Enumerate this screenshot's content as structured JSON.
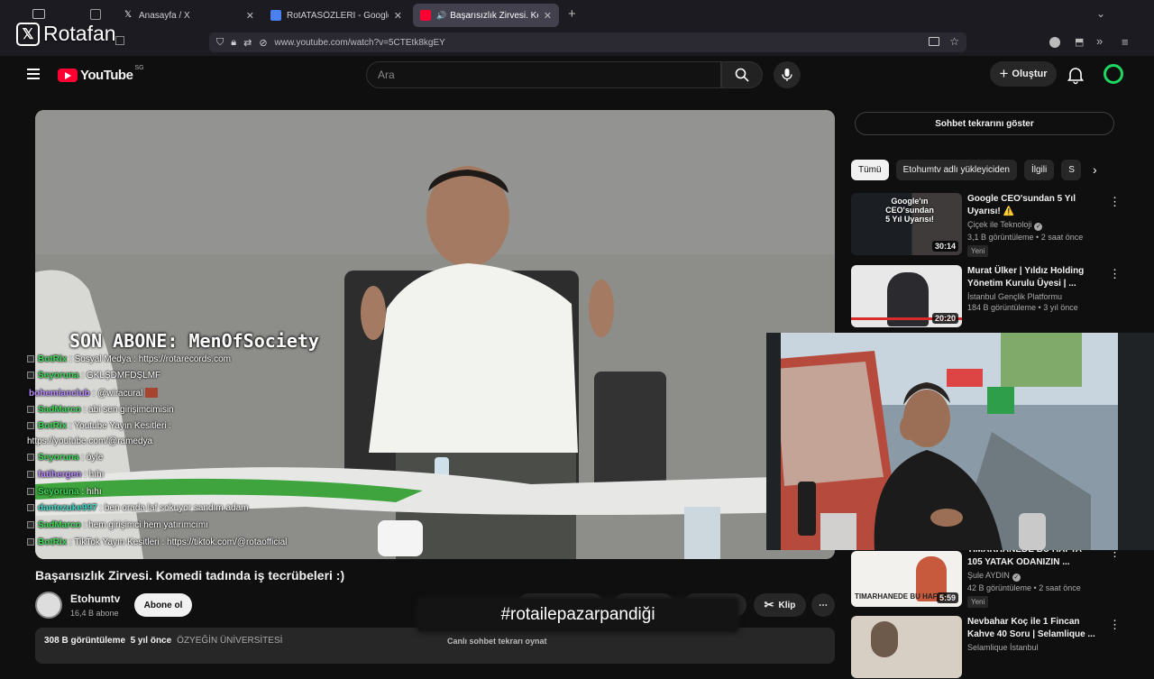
{
  "overlay": {
    "brand": "Rotafan"
  },
  "browser": {
    "tabs": [
      {
        "title": "Anasayfa / X",
        "icon": "x-icon"
      },
      {
        "title": "RotATASÖZLERİ - Google Doküman",
        "icon": "docs-icon"
      },
      {
        "title": "Başarısızlık Zirvesi. Komedi tadında",
        "icon": "youtube-icon",
        "active": true
      }
    ],
    "url": "www.youtube.com/watch?v=5CTEtk8kgEY"
  },
  "header": {
    "logo_text": "YouTube",
    "region": "SG",
    "search_placeholder": "Ara",
    "create_label": "Oluştur"
  },
  "player": {
    "overlay_text": "SON ABONE: MenOfSociety",
    "chat": [
      {
        "name": "BotRix",
        "color": "#41d95b",
        "text": ": Sosyal Medya : https://rotarecords.com"
      },
      {
        "name": "Seyoruna",
        "color": "#41d95b",
        "text": ": GKLŞDMFDŞLMF"
      },
      {
        "name": "bohemianclub",
        "color": "#b98cff",
        "text": ": @wiracural"
      },
      {
        "name": "SadMarco",
        "color": "#41d95b",
        "text": ": abi sen girişimcimisin"
      },
      {
        "name": "BotRix",
        "color": "#41d95b",
        "text": ": Youtube Yayın Kesitleri :"
      },
      {
        "name": "",
        "color": "#ffffff",
        "text": "https://youtube.com/@ramedya"
      },
      {
        "name": "Seyoruna",
        "color": "#41d95b",
        "text": ": öyle"
      },
      {
        "name": "fatihergen",
        "color": "#b98cff",
        "text": ": hıhı"
      },
      {
        "name": "Seyoruna",
        "color": "#41d95b",
        "text": ": hıhı"
      },
      {
        "name": "dantezuke997",
        "color": "#41d9c8",
        "text": ": ben orada laf sokuyor sandım adam"
      },
      {
        "name": "SadMarco",
        "color": "#41d95b",
        "text": ": hem girişimci hem yatırımcımı"
      },
      {
        "name": "BotRix",
        "color": "#41d95b",
        "text": ": TikTok Yayın Kesitleri : https://tiktok.com/@rotaofficial"
      }
    ]
  },
  "video": {
    "title": "Başarısızlık Zirvesi. Komedi tadında iş tecrübeleri :)",
    "channel": "Etohumtv",
    "subscribers": "16,4 B abone",
    "subscribe_label": "Abone ol",
    "clip_label": "Klip",
    "views": "308 B görüntüleme",
    "age": "5 yıl önce",
    "desc_channel": "ÖZYEĞİN ÜNİVERSİTESİ"
  },
  "banner": {
    "hashtag": "#rotailepazarpandiği"
  },
  "live_replay": "Canlı sohbet tekrarı oynat",
  "sidebar": {
    "chat_replay_label": "Sohbet tekrarını göster",
    "chips": [
      "Tümü",
      "Etohumtv adlı yükleyiciden",
      "İlgili",
      "S"
    ],
    "recs": [
      {
        "title": "Google CEO'sundan 5 Yıl Uyarısı! ⚠️",
        "channel": "Çiçek ile Teknoloji",
        "verified": true,
        "meta": "3,1 B görüntüleme • 2 saat önce",
        "badge": "Yeni",
        "duration": "30:14",
        "thumb_text": "Google'ın CEO'sundan 5 Yıl Uyarısı!"
      },
      {
        "title": "Murat Ülker | Yıldız Holding Yönetim Kurulu Üyesi | ...",
        "channel": "İstanbul Gençlik Platformu",
        "verified": false,
        "meta": "184 B görüntüleme • 3 yıl önce",
        "badge": "",
        "duration": "20:20"
      },
      {
        "title": "TIMARHANEDE BU HAFTA - 105 YATAK ODANIZIN ...",
        "channel": "Şule AYDIN",
        "verified": true,
        "meta": "42 B görüntüleme • 2 saat önce",
        "badge": "Yeni",
        "duration": "5:59",
        "thumb_text": "TIMARHANEDE BU HAF"
      },
      {
        "title": "Nevbahar Koç ile 1 Fincan Kahve 40 Soru | Selamlique ...",
        "channel": "Selamlique İstanbul",
        "verified": false,
        "meta": "",
        "badge": "",
        "duration": ""
      }
    ]
  }
}
